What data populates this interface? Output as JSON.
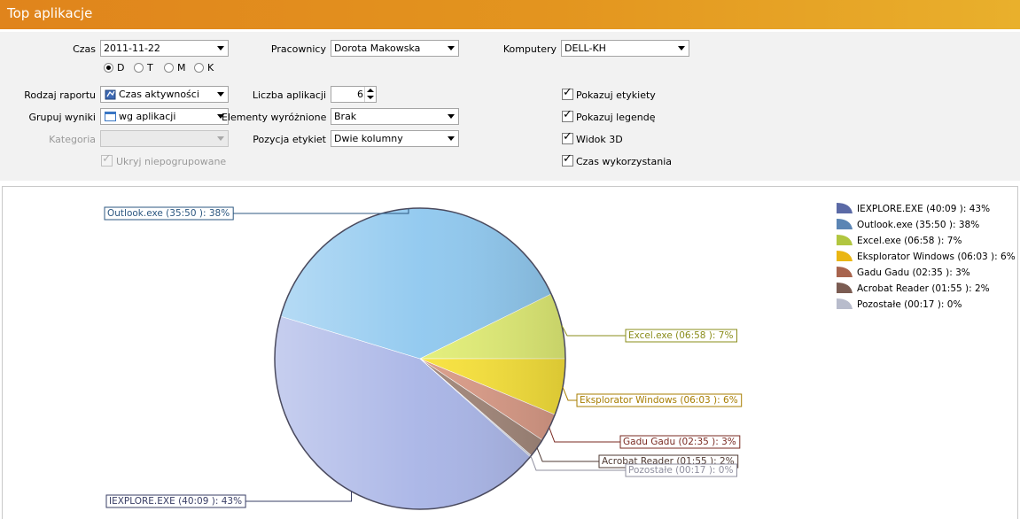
{
  "title": "Top aplikacje",
  "filters": {
    "czas": {
      "label": "Czas",
      "value": "2011-11-22"
    },
    "period": [
      {
        "label": "D",
        "selected": true
      },
      {
        "label": "T",
        "selected": false
      },
      {
        "label": "M",
        "selected": false
      },
      {
        "label": "K",
        "selected": false
      }
    ],
    "pracownicy": {
      "label": "Pracownicy",
      "value": "Dorota Makowska"
    },
    "komputery": {
      "label": "Komputery",
      "value": "DELL-KH"
    },
    "rodzaj_raportu": {
      "label": "Rodzaj raportu",
      "value": "Czas aktywności"
    },
    "liczba_aplikacji": {
      "label": "Liczba aplikacji",
      "value": "6"
    },
    "grupuj_wyniki": {
      "label": "Grupuj wyniki",
      "value": "wg aplikacji"
    },
    "elementy_wyroznione": {
      "label": "Elementy wyróżnione",
      "value": "Brak"
    },
    "kategoria": {
      "label": "Kategoria",
      "value": ""
    },
    "pozycja_etykiet": {
      "label": "Pozycja etykiet",
      "value": "Dwie kolumny"
    },
    "ukryj": {
      "label": "Ukryj niepogrupowane",
      "checked": true,
      "disabled": true
    }
  },
  "options": [
    {
      "label": "Pokazuj etykiety",
      "checked": true
    },
    {
      "label": "Pokazuj legendę",
      "checked": true
    },
    {
      "label": "Widok 3D",
      "checked": true
    },
    {
      "label": "Czas wykorzystania",
      "checked": true
    }
  ],
  "chart_data": {
    "type": "pie",
    "slices": [
      {
        "label": "IEXPLORE.EXE (40:09 ): 43%",
        "time": "40:09",
        "percent": 43,
        "color": "#a8b4e6",
        "legend_color": "#5b6aa6",
        "label_color": "#3a3f66"
      },
      {
        "label": "Outlook.exe (35:50 ): 38%",
        "time": "35:50",
        "percent": 38,
        "color": "#8fc8ef",
        "legend_color": "#5b85b4",
        "label_color": "#2c5780"
      },
      {
        "label": "Excel.exe (06:58 ): 7%",
        "time": "06:58",
        "percent": 7,
        "color": "#e2ee76",
        "legend_color": "#b1c640",
        "label_color": "#8a8c1a"
      },
      {
        "label": "Eksplorator Windows (06:03 ): 6%",
        "time": "06:03",
        "percent": 6,
        "color": "#f8e23a",
        "legend_color": "#eab613",
        "label_color": "#a77d00"
      },
      {
        "label": "Gadu Gadu (02:35 ): 3%",
        "time": "02:35",
        "percent": 3,
        "color": "#d99a86",
        "legend_color": "#a8644e",
        "label_color": "#7a2a22"
      },
      {
        "label": "Acrobat Reader (01:55 ): 2%",
        "time": "01:55",
        "percent": 2,
        "color": "#a08578",
        "legend_color": "#7b5c52",
        "label_color": "#4f3a33"
      },
      {
        "label": "Pozostałe (00:17 ): 0%",
        "time": "00:17",
        "percent": 0,
        "color": "#c8cbd8",
        "legend_color": "#b8bccc",
        "label_color": "#8f8f9f"
      }
    ],
    "legend": "top-right"
  }
}
